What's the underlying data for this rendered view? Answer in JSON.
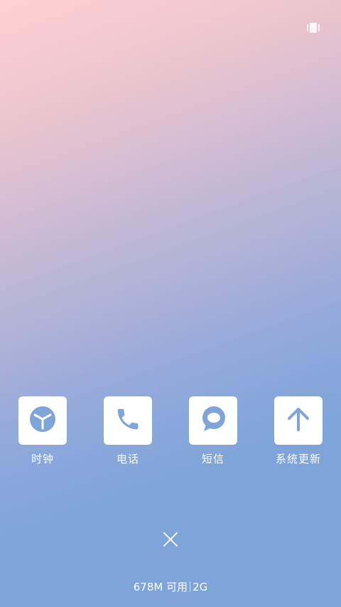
{
  "header": {
    "recent_view_icon": "card-stack-icon"
  },
  "apps": [
    {
      "label": "时钟",
      "icon": "clock-icon"
    },
    {
      "label": "电话",
      "icon": "phone-icon"
    },
    {
      "label": "短信",
      "icon": "message-bubble-icon"
    },
    {
      "label": "系统更新",
      "icon": "arrow-up-icon"
    }
  ],
  "close": {
    "icon": "close-icon"
  },
  "status": {
    "memory": "678M 可用",
    "network": "2G"
  },
  "colors": {
    "gradient_top": "#ffd0d1",
    "gradient_bottom": "#7fa4da",
    "icon_accent": "#7fa4da",
    "text": "#ffffff"
  }
}
